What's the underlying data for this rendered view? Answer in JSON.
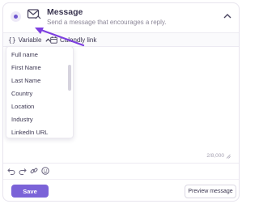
{
  "header": {
    "title": "Message",
    "subtitle": "Send a message that encourages a reply."
  },
  "toolbar": {
    "variable_label": "Variable",
    "calendly_label": "Calendly link"
  },
  "variable_menu": {
    "items": [
      "Full name",
      "First Name",
      "Last Name",
      "Country",
      "Location",
      "Industry",
      "LinkedIn URL"
    ]
  },
  "editor": {
    "char_count": "2/8,000"
  },
  "actions": {
    "save_label": "Save",
    "preview_label": "Preview message"
  },
  "colors": {
    "accent": "#6e56cf",
    "save_button": "#7b63d8",
    "annotation_arrow": "#7d3fe0"
  },
  "icons": [
    "message-icon",
    "collapse-chevron-icon",
    "braces-icon",
    "calendar-icon",
    "undo-icon",
    "redo-icon",
    "link-icon",
    "emoji-icon",
    "resize-icon"
  ]
}
